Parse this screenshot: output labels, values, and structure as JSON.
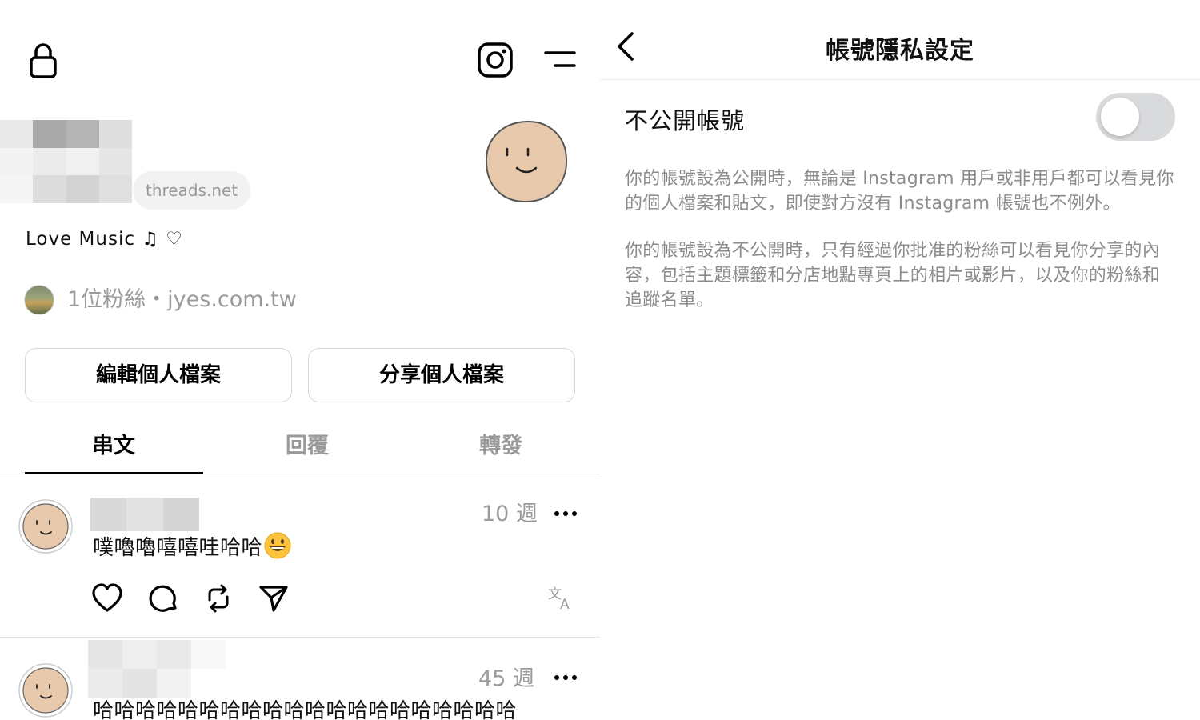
{
  "profile": {
    "threads_chip": "threads.net",
    "bio": "Love Music ♫ ♡",
    "followers_text": "1位粉絲・jyes.com.tw",
    "buttons": {
      "edit": "編輯個人檔案",
      "share": "分享個人檔案"
    },
    "tabs": [
      "串文",
      "回覆",
      "轉發"
    ],
    "active_tab": "串文"
  },
  "posts": [
    {
      "time": "10 週",
      "text": "噗嚕嚕嘻嘻哇哈哈",
      "emoji": "grinning-face"
    },
    {
      "time": "45 週",
      "text": "哈哈哈哈哈哈哈哈哈哈哈哈哈哈哈哈哈哈哈哈"
    }
  ],
  "privacy": {
    "title": "帳號隱私設定",
    "private_account_label": "不公開帳號",
    "private_account_enabled": false,
    "description_public": "你的帳號設為公開時，無論是 Instagram 用戶或非用戶都可以看見你的個人檔案和貼文，即使對方沒有 Instagram 帳號也不例外。",
    "description_private": "你的帳號設為不公開時，只有經過你批准的粉絲可以看見你分享的內容，包括主題標籤和分店地點專頁上的相片或影片，以及你的粉絲和追蹤名單。"
  },
  "colors": {
    "avatar_fill": "#e8c9ab",
    "muted_text": "#9a9a9a",
    "toggle_off": "#d9dadc"
  }
}
